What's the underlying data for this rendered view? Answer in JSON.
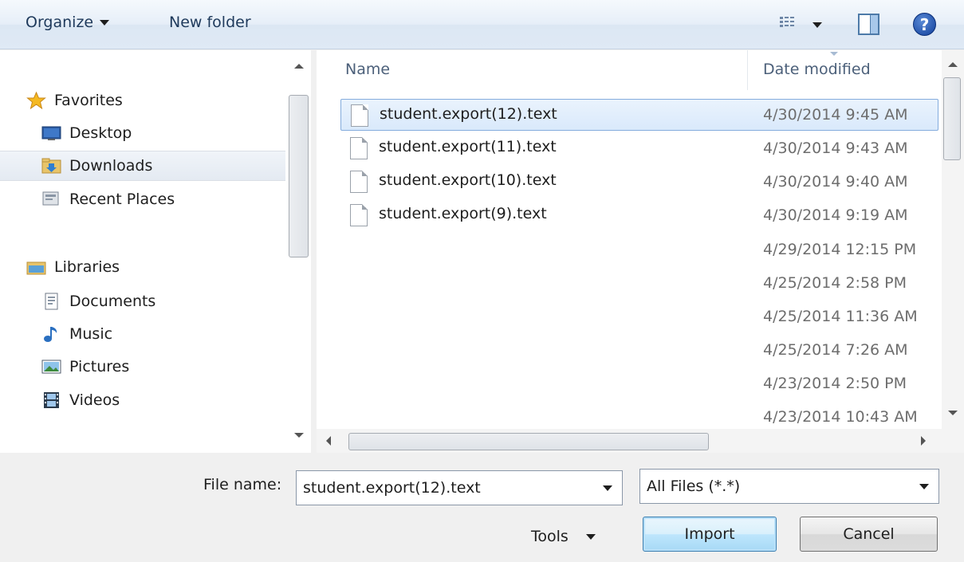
{
  "toolbar": {
    "organize_label": "Organize",
    "new_folder_label": "New folder",
    "help_label": "?"
  },
  "nav": {
    "favorites_label": "Favorites",
    "favorites": [
      "Desktop",
      "Downloads",
      "Recent Places"
    ],
    "selected": "Downloads",
    "libraries_label": "Libraries",
    "libraries": [
      "Documents",
      "Music",
      "Pictures",
      "Videos"
    ]
  },
  "list": {
    "columns": {
      "name": "Name",
      "date": "Date modified"
    },
    "files": [
      {
        "name": "student.export(12).text",
        "date": "4/30/2014 9:45 AM"
      },
      {
        "name": "student.export(11).text",
        "date": "4/30/2014 9:43 AM"
      },
      {
        "name": "student.export(10).text",
        "date": "4/30/2014 9:40 AM"
      },
      {
        "name": "student.export(9).text",
        "date": "4/30/2014 9:19 AM"
      }
    ],
    "hidden_row_dates": [
      "4/29/2014 12:15 PM",
      "4/25/2014 2:58 PM",
      "4/25/2014 11:36 AM",
      "4/25/2014 7:26 AM",
      "4/23/2014 2:50 PM",
      "4/23/2014 10:43 AM"
    ]
  },
  "footer": {
    "file_name_label": "File name:",
    "file_name_value": "student.export(12).text",
    "file_type_value": "All Files (*.*)",
    "tools_label": "Tools",
    "import_label": "Import",
    "cancel_label": "Cancel"
  },
  "colors": {
    "toolbar_text": "#1e395b",
    "selection_border": "#84acdd",
    "primary_border": "#3c7fb1"
  }
}
